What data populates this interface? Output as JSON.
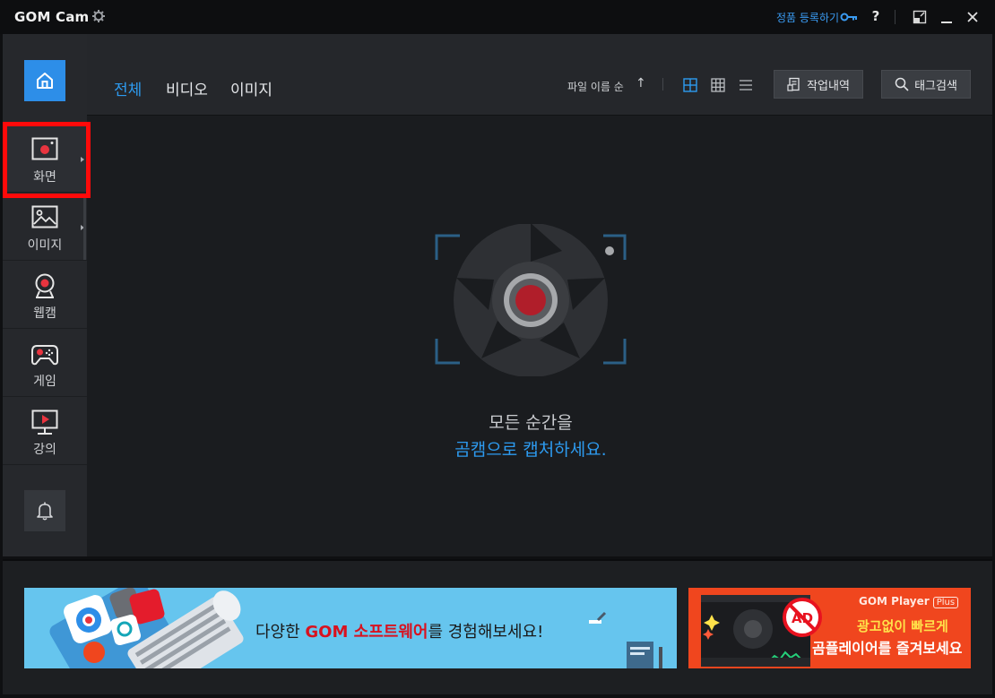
{
  "titlebar": {
    "app_name": "GOM Cam",
    "register_link": "정품 등록하기",
    "help": "?"
  },
  "sidebar": {
    "items": [
      {
        "label": "화면",
        "icon": "screen-record-icon"
      },
      {
        "label": "이미지",
        "icon": "image-icon"
      },
      {
        "label": "웹캠",
        "icon": "webcam-icon"
      },
      {
        "label": "게임",
        "icon": "gamepad-icon"
      },
      {
        "label": "강의",
        "icon": "lecture-icon"
      }
    ]
  },
  "filter_bar": {
    "tabs": [
      {
        "label": "전체",
        "active": true
      },
      {
        "label": "비디오",
        "active": false
      },
      {
        "label": "이미지",
        "active": false
      }
    ],
    "sort_label": "파일 이름 순",
    "sort_direction": "↑",
    "view_modes": [
      "large-grid",
      "small-grid",
      "list"
    ],
    "history_button": "작업내역",
    "tag_search_button": "태그검색"
  },
  "empty_state": {
    "line1": "모든 순간을",
    "line2": "곰캠으로 캡처하세요."
  },
  "ads": {
    "main_prefix": "다양한 ",
    "main_highlight": "GOM 소프트웨어",
    "main_suffix": "를 경험해보세요!",
    "gp_brand": "GOM Player",
    "gp_plus": "Plus",
    "gp_line1": "광고없이 빠르게",
    "gp_line2": "곰플레이어를 즐겨보세요",
    "ad_badge": "AD"
  },
  "colors": {
    "accent": "#2d9bf0",
    "highlight_box": "#ff0a0a",
    "record_red": "#b01e2a"
  }
}
